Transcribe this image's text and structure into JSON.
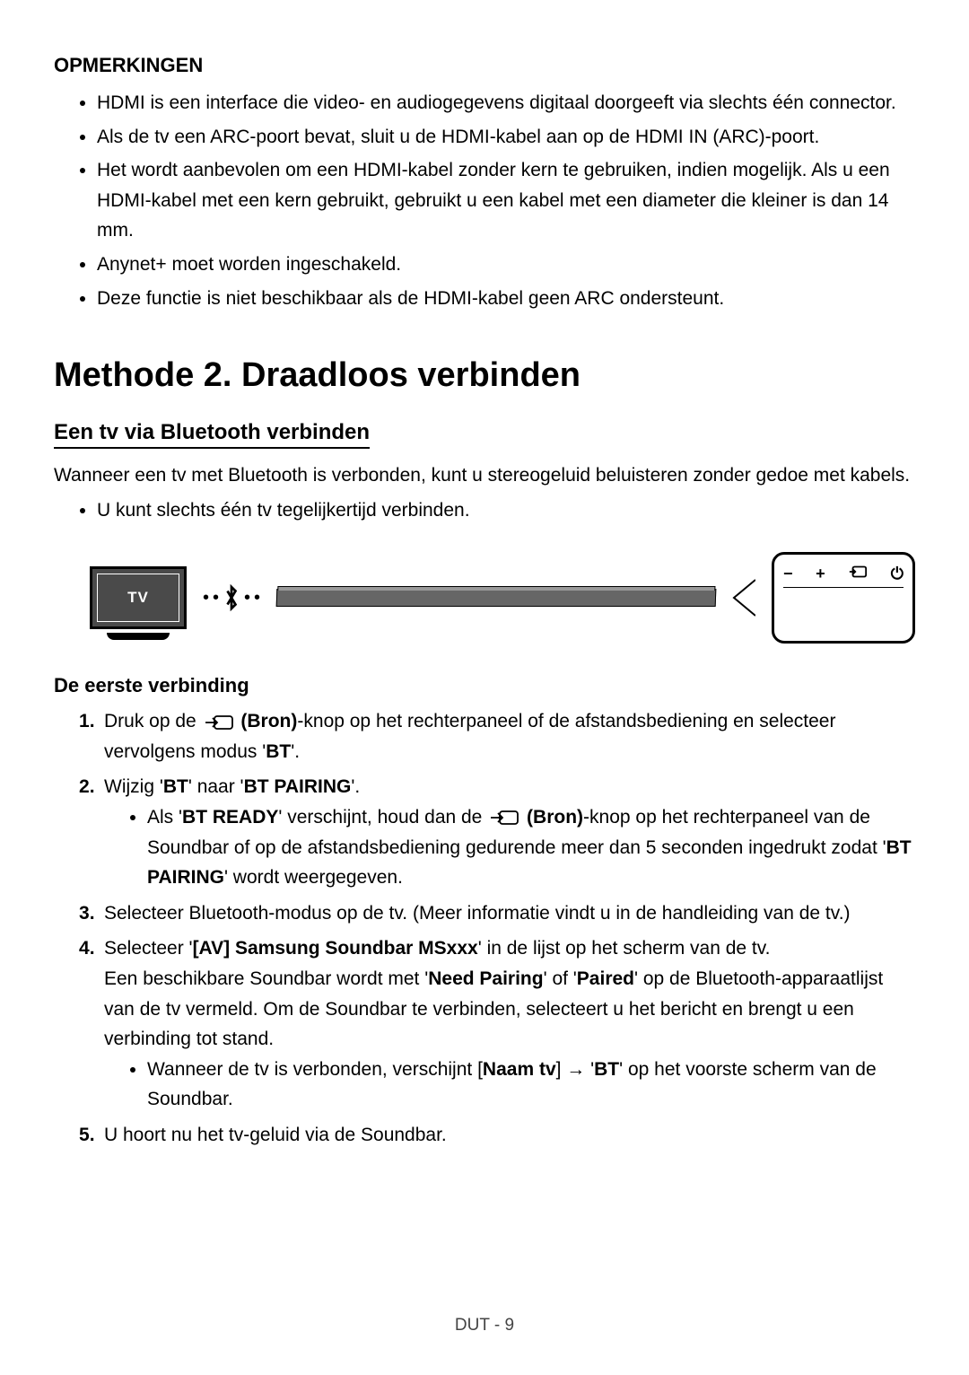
{
  "notes": {
    "title": "OPMERKINGEN",
    "items": [
      "HDMI is een interface die video- en audiogegevens digitaal doorgeeft via slechts één connector.",
      "Als de tv een ARC-poort bevat, sluit u de HDMI-kabel aan op de HDMI IN (ARC)-poort.",
      "Het wordt aanbevolen om een HDMI-kabel zonder kern te gebruiken, indien mogelijk. Als u een HDMI-kabel met een kern gebruikt, gebruikt u een kabel met een diameter die kleiner is dan 14 mm.",
      "Anynet+ moet worden ingeschakeld.",
      "Deze functie is niet beschikbaar als de HDMI-kabel geen ARC ondersteunt."
    ]
  },
  "method": {
    "heading": "Methode 2. Draadloos verbinden",
    "subsection": "Een tv via Bluetooth verbinden",
    "intro": "Wanneer een tv met Bluetooth is verbonden, kunt u stereogeluid beluisteren zonder gedoe met kabels.",
    "sub_bullet": "U kunt slechts één tv tegelijkertijd verbinden."
  },
  "diagram": {
    "tv_label": "TV",
    "remote_minus": "−",
    "remote_plus": "+",
    "remote_power": "⏻"
  },
  "first_conn": {
    "title": "De eerste verbinding",
    "step1_a": "Druk op de ",
    "step1_b": " (Bron)",
    "step1_c": "-knop op het rechterpaneel of de afstandsbediening en selecteer vervolgens modus '",
    "step1_d": "BT",
    "step1_e": "'.",
    "step2_a": "Wijzig '",
    "step2_b": "BT",
    "step2_c": "' naar '",
    "step2_d": "BT PAIRING",
    "step2_e": "'.",
    "step2_sub_a": "Als '",
    "step2_sub_b": "BT READY",
    "step2_sub_c": "' verschijnt, houd dan de ",
    "step2_sub_d": " (Bron)",
    "step2_sub_e": "-knop op het rechterpaneel van de Soundbar of op de afstandsbediening gedurende meer dan 5 seconden ingedrukt zodat '",
    "step2_sub_f": "BT PAIRING",
    "step2_sub_g": "' wordt weergegeven.",
    "step3": "Selecteer Bluetooth-modus op de tv. (Meer informatie vindt u in de handleiding van de tv.)",
    "step4_a": "Selecteer '",
    "step4_b": "[AV] Samsung Soundbar MSxxx",
    "step4_c": "' in de lijst op het scherm van de tv.",
    "step4_d": "Een beschikbare Soundbar wordt met '",
    "step4_e": "Need Pairing",
    "step4_f": "' of '",
    "step4_g": "Paired",
    "step4_h": "' op de Bluetooth-apparaatlijst van de tv vermeld. Om de Soundbar te verbinden, selecteert u het bericht en brengt u een verbinding tot stand.",
    "step4_sub_a": "Wanneer de tv is verbonden, verschijnt [",
    "step4_sub_b": "Naam tv",
    "step4_sub_c": "] → '",
    "step4_sub_d": "BT",
    "step4_sub_e": "' op het voorste scherm van de Soundbar.",
    "step5": "U hoort nu het tv-geluid via de Soundbar."
  },
  "footer": "DUT - 9"
}
